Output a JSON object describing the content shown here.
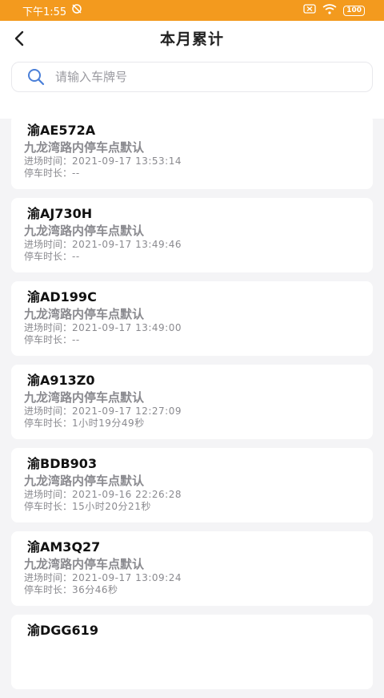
{
  "status_bar": {
    "time": "下午1:55",
    "battery": "100",
    "color": "#f39a1e"
  },
  "header": {
    "title": "本月累计"
  },
  "search": {
    "placeholder": "请输入车牌号",
    "value": ""
  },
  "labels": {
    "entry_time": "进场时间：",
    "duration": "停车时长："
  },
  "records": [
    {
      "plate": "渝AE572A",
      "location": "九龙湾路内停车点默认",
      "entry_time": "2021-09-17 13:53:14",
      "duration": "--"
    },
    {
      "plate": "渝AJ730H",
      "location": "九龙湾路内停车点默认",
      "entry_time": "2021-09-17 13:49:46",
      "duration": "--"
    },
    {
      "plate": "渝AD199C",
      "location": "九龙湾路内停车点默认",
      "entry_time": "2021-09-17 13:49:00",
      "duration": "--"
    },
    {
      "plate": "渝A913Z0",
      "location": "九龙湾路内停车点默认",
      "entry_time": "2021-09-17 12:27:09",
      "duration": "1小时19分49秒"
    },
    {
      "plate": "渝BDB903",
      "location": "九龙湾路内停车点默认",
      "entry_time": "2021-09-16 22:26:28",
      "duration": "15小时20分21秒"
    },
    {
      "plate": "渝AM3Q27",
      "location": "九龙湾路内停车点默认",
      "entry_time": "2021-09-17 13:09:24",
      "duration": "36分46秒"
    },
    {
      "plate": "渝DGG619",
      "location": "",
      "entry_time": "",
      "duration": ""
    }
  ]
}
